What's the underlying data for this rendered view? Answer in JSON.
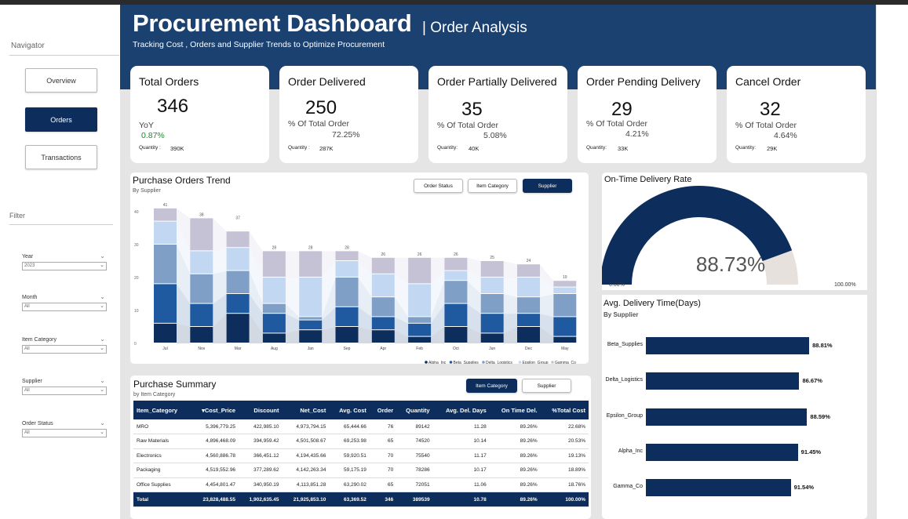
{
  "sidebar": {
    "navigator_title": "Navigator",
    "nav": [
      "Overview",
      "Orders",
      "Transactions"
    ],
    "active_nav": "Orders",
    "filter_title": "Filter",
    "slicers": [
      {
        "label": "Year",
        "value": "2023"
      },
      {
        "label": "Month",
        "value": "All"
      },
      {
        "label": "Item Category",
        "value": "All"
      },
      {
        "label": "Supplier",
        "value": "All"
      },
      {
        "label": "Order Status",
        "value": "All"
      }
    ]
  },
  "header": {
    "title": "Procurement Dashboard",
    "subtitle": "| Order Analysis",
    "description": "Tracking Cost , Orders and Supplier Trends to Optimize Procurement"
  },
  "cards": [
    {
      "title": "Total Orders",
      "value": "346",
      "sub": "YoY",
      "pct": "0.87%",
      "pct_color": "#1a8a2e",
      "qty_label": "Quantity :",
      "qty": "390K"
    },
    {
      "title": "Order Delivered",
      "value": "250",
      "sub": "% Of Total Order",
      "pct": "72.25%",
      "qty_label": "Quantity :",
      "qty": "287K"
    },
    {
      "title": "Order Partially Delivered",
      "value": "35",
      "sub": "% Of Total Order",
      "pct": "5.08%",
      "qty_label": "Quantity:",
      "qty": "40K"
    },
    {
      "title": "Order Pending Delivery",
      "value": "29",
      "sub": "% Of Total Order",
      "pct": "4.21%",
      "qty_label": "Quantity:",
      "qty": "33K"
    },
    {
      "title": "Cancel Order",
      "value": "32",
      "sub": "% Of Total Order",
      "pct": "4.64%",
      "qty_label": "Quantity:",
      "qty": "29K"
    }
  ],
  "trend": {
    "title": "Purchase Orders Trend",
    "subtitle": "By Supplier",
    "buttons": [
      "Order Status",
      "Item Category",
      "Supplier"
    ],
    "active_button": "Supplier"
  },
  "summary": {
    "title": "Purchase Summary",
    "subtitle": "by Item Category",
    "buttons": [
      "Item Category",
      "Supplier"
    ],
    "active_button": "Item Category",
    "columns": [
      "Item_Category",
      "Cost_Price",
      "Discount",
      "Net_Cost",
      "Avg. Cost",
      "Order",
      "Quantity",
      "Avg. Del. Days",
      "On Time Del.",
      "%Total Cost"
    ],
    "rows": [
      [
        "MRO",
        "5,396,779.25",
        "422,985.10",
        "4,973,794.15",
        "65,444.66",
        "76",
        "89142",
        "11.28",
        "89.26%",
        "22.68%"
      ],
      [
        "Raw Materials",
        "4,896,468.09",
        "394,959.42",
        "4,501,508.67",
        "69,253.98",
        "65",
        "74520",
        "10.14",
        "89.26%",
        "20.53%"
      ],
      [
        "Electronics",
        "4,560,886.78",
        "366,451.12",
        "4,194,435.66",
        "59,920.51",
        "70",
        "75540",
        "11.17",
        "89.26%",
        "19.13%"
      ],
      [
        "Packaging",
        "4,519,552.96",
        "377,289.62",
        "4,142,263.34",
        "59,175.19",
        "70",
        "78286",
        "10.17",
        "89.26%",
        "18.89%"
      ],
      [
        "Office Supplies",
        "4,454,801.47",
        "340,950.19",
        "4,113,851.28",
        "63,290.02",
        "65",
        "72051",
        "11.06",
        "89.26%",
        "18.76%"
      ]
    ],
    "total": [
      "Total",
      "23,828,488.55",
      "1,902,635.45",
      "21,925,853.10",
      "63,369.52",
      "346",
      "389539",
      "10.78",
      "89.26%",
      "100.00%"
    ]
  },
  "ontime": {
    "title": "On-Time Delivery Rate",
    "value_label": "88.73%",
    "value": 88.73,
    "min_label": "0.00%",
    "max_label": "100.00%"
  },
  "avgdel": {
    "title": "Avg. Delivery Time(Days)",
    "subtitle": "By Supplier"
  },
  "chart_data": [
    {
      "type": "bar",
      "stacked": true,
      "title": "Purchase Orders Trend",
      "subtitle": "By Supplier",
      "categories": [
        "Jul",
        "Nov",
        "Mar",
        "Aug",
        "Jan",
        "Sep",
        "Apr",
        "Feb",
        "Oct",
        "Jun",
        "Dec",
        "May"
      ],
      "totals": [
        41,
        38,
        37,
        28,
        28,
        28,
        26,
        26,
        26,
        25,
        24,
        19
      ],
      "ylim": [
        0,
        40
      ],
      "yticks": [
        0,
        10,
        20,
        30,
        40
      ],
      "legend_position": "bottom-right",
      "series": [
        {
          "name": "Alpha_Inc",
          "color": "#0d2e5c",
          "values": [
            6,
            5,
            9,
            3,
            4,
            5,
            4,
            2,
            5,
            3,
            5,
            2
          ]
        },
        {
          "name": "Beta_Supplies",
          "color": "#1f5aa0",
          "values": [
            12,
            7,
            6,
            6,
            3,
            6,
            4,
            4,
            7,
            6,
            4,
            6
          ]
        },
        {
          "name": "Delta_Logistics",
          "color": "#7f9fc7",
          "values": [
            12,
            9,
            7,
            3,
            1,
            9,
            6,
            2,
            7,
            6,
            5,
            7
          ]
        },
        {
          "name": "Epsilon_Group",
          "color": "#c2d7f1",
          "values": [
            7,
            7,
            7,
            8,
            12,
            5,
            7,
            10,
            3,
            5,
            6,
            2
          ]
        },
        {
          "name": "Gamma_Co",
          "color": "#c6c2d6",
          "values": [
            4,
            10,
            5,
            8,
            8,
            3,
            5,
            8,
            4,
            5,
            4,
            2
          ]
        }
      ]
    },
    {
      "type": "bar",
      "orientation": "horizontal",
      "title": "Avg. Delivery Time(Days)",
      "subtitle": "By Supplier",
      "categories": [
        "Beta_Supplies",
        "Delta_Logistics",
        "Epsilon_Group",
        "Alpha_Inc",
        "Gamma_Co"
      ],
      "values": [
        88.81,
        86.67,
        88.59,
        91.45,
        91.54
      ],
      "value_labels": [
        "88.81%",
        "86.67%",
        "88.59%",
        "91.45%",
        "91.54%"
      ],
      "bar_lengths": [
        11.5,
        10.8,
        11.35,
        10.7,
        10.2
      ],
      "color": "#0d2e5c"
    }
  ]
}
